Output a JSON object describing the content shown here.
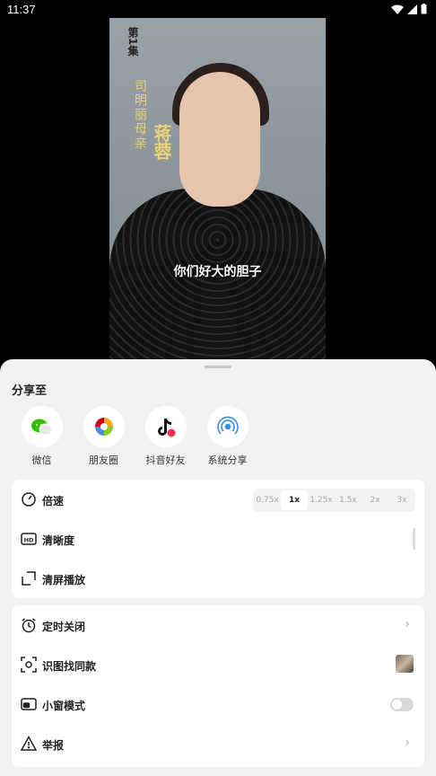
{
  "status_bar": {
    "time": "11:37"
  },
  "video": {
    "episode": "第1集",
    "role": "司明丽母亲",
    "actor_name": "蒋蓉",
    "subtitle": "你们好大的胆子"
  },
  "share_sheet": {
    "title": "分享至",
    "targets": [
      {
        "label": "微信",
        "icon": "wechat-icon"
      },
      {
        "label": "朋友圈",
        "icon": "moments-icon"
      },
      {
        "label": "抖音好友",
        "icon": "douyin-icon"
      },
      {
        "label": "系统分享",
        "icon": "system-share-icon"
      }
    ]
  },
  "settings_card": {
    "speed_label": "倍速",
    "speeds": [
      "0.75x",
      "1x",
      "1.25x",
      "1.5x",
      "2x",
      "3x"
    ],
    "selected_speed": "1x",
    "definition_label": "清晰度",
    "clear_screen_label": "清屏播放"
  },
  "options_card": {
    "timer_label": "定时关闭",
    "identify_label": "识图找同款",
    "pip_label": "小窗模式",
    "pip_enabled": false,
    "report_label": "举报"
  },
  "colors": {
    "sheet_bg": "#f2f2f4",
    "caption_gold": "#e9d27a"
  }
}
